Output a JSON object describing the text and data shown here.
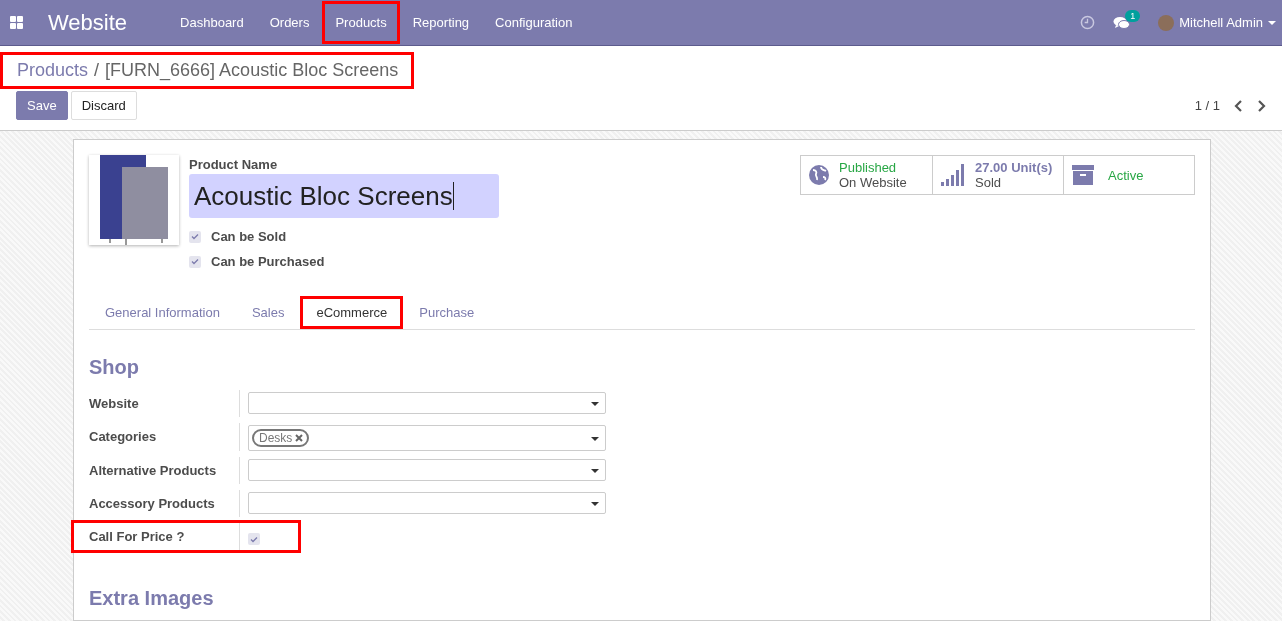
{
  "app": {
    "title": "Website"
  },
  "menu": [
    {
      "label": "Dashboard",
      "highlighted": false
    },
    {
      "label": "Orders",
      "highlighted": false
    },
    {
      "label": "Products",
      "highlighted": true
    },
    {
      "label": "Reporting",
      "highlighted": false
    },
    {
      "label": "Configuration",
      "highlighted": false
    }
  ],
  "systray": {
    "messages_badge": "1",
    "user": "Mitchell Admin"
  },
  "breadcrumb": {
    "parent": "Products",
    "separator": "/",
    "current": "[FURN_6666] Acoustic Bloc Screens",
    "highlighted": true
  },
  "buttons": {
    "save": "Save",
    "discard": "Discard"
  },
  "pager": {
    "value": "1 / 1"
  },
  "product": {
    "name_label": "Product Name",
    "name": "Acoustic Bloc Screens",
    "options": [
      {
        "label": "Can be Sold",
        "checked": true
      },
      {
        "label": "Can be Purchased",
        "checked": true
      }
    ]
  },
  "stat_buttons": [
    {
      "kind": "publish",
      "line1": "Published",
      "line2": "On Website"
    },
    {
      "kind": "sold",
      "value": "27.00",
      "unit": "Unit(s)",
      "line2": "Sold"
    },
    {
      "kind": "active",
      "line1": "Active"
    }
  ],
  "tabs": [
    {
      "label": "General Information",
      "selected": false,
      "highlighted": false
    },
    {
      "label": "Sales",
      "selected": false,
      "highlighted": false
    },
    {
      "label": "eCommerce",
      "selected": true,
      "highlighted": true
    },
    {
      "label": "Purchase",
      "selected": false,
      "highlighted": false
    }
  ],
  "shop": {
    "title": "Shop",
    "fields": [
      {
        "kind": "select",
        "label": "Website",
        "highlighted": false
      },
      {
        "kind": "tags",
        "label": "Categories",
        "tags": [
          "Desks"
        ],
        "highlighted": false
      },
      {
        "kind": "select",
        "label": "Alternative Products",
        "highlighted": false
      },
      {
        "kind": "select",
        "label": "Accessory Products",
        "highlighted": false
      },
      {
        "kind": "checkbox",
        "label": "Call For Price ?",
        "checked": true,
        "highlighted": true
      }
    ]
  },
  "extra_images": {
    "title": "Extra Images"
  }
}
